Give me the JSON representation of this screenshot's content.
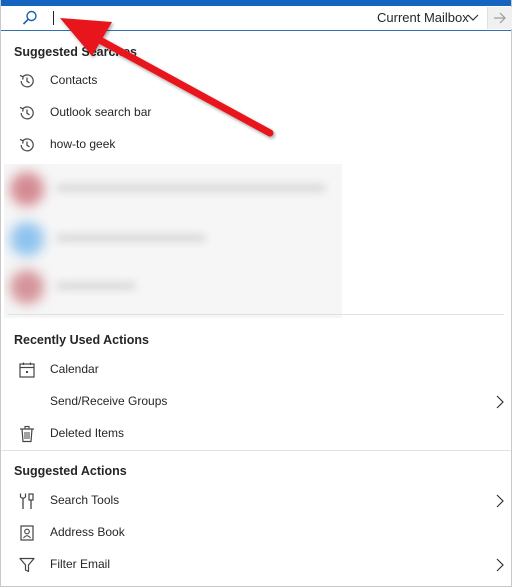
{
  "search": {
    "value": "",
    "scope_label": "Current Mailbox"
  },
  "suggested_searches": {
    "header": "Suggested Searches",
    "items": [
      {
        "label": "Contacts",
        "icon": "history-icon"
      },
      {
        "label": "Outlook search bar",
        "icon": "history-icon"
      },
      {
        "label": "how-to geek",
        "icon": "history-icon"
      }
    ]
  },
  "recently_used_actions": {
    "header": "Recently Used Actions",
    "items": [
      {
        "label": "Calendar",
        "icon": "calendar-icon",
        "has_submenu": false
      },
      {
        "label": "Send/Receive Groups",
        "icon": "",
        "has_submenu": true
      },
      {
        "label": "Deleted Items",
        "icon": "trash-icon",
        "has_submenu": false
      }
    ]
  },
  "suggested_actions": {
    "header": "Suggested Actions",
    "items": [
      {
        "label": "Search Tools",
        "icon": "tools-icon",
        "has_submenu": true
      },
      {
        "label": "Address Book",
        "icon": "address-book-icon",
        "has_submenu": false
      },
      {
        "label": "Filter Email",
        "icon": "filter-icon",
        "has_submenu": true
      }
    ]
  },
  "colors": {
    "accent": "#1565c0",
    "annotation_arrow": "#e8131b",
    "text": "#262626"
  }
}
